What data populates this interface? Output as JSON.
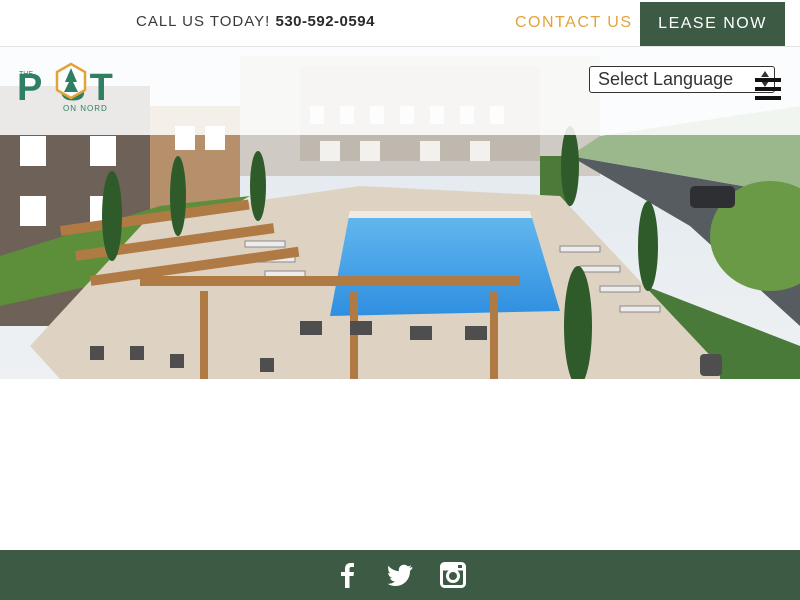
{
  "topbar": {
    "call_label": "CALL US TODAY!",
    "phone": "530-592-0594",
    "contact_label": "CONTACT US",
    "lease_label": "LEASE NOW"
  },
  "logo": {
    "the": "THE",
    "post": "P  ST",
    "on_nord": "ON NORD"
  },
  "language": {
    "selected": "Select Language"
  },
  "hero": {
    "image_icon": "pool-courtyard-rendering"
  },
  "footer": {
    "social_icons": [
      "facebook-icon",
      "twitter-icon",
      "instagram-icon"
    ]
  },
  "colors": {
    "brand_green": "#3d5a45",
    "accent_orange": "#e3a33b",
    "logo_teal": "#2f7f62"
  }
}
